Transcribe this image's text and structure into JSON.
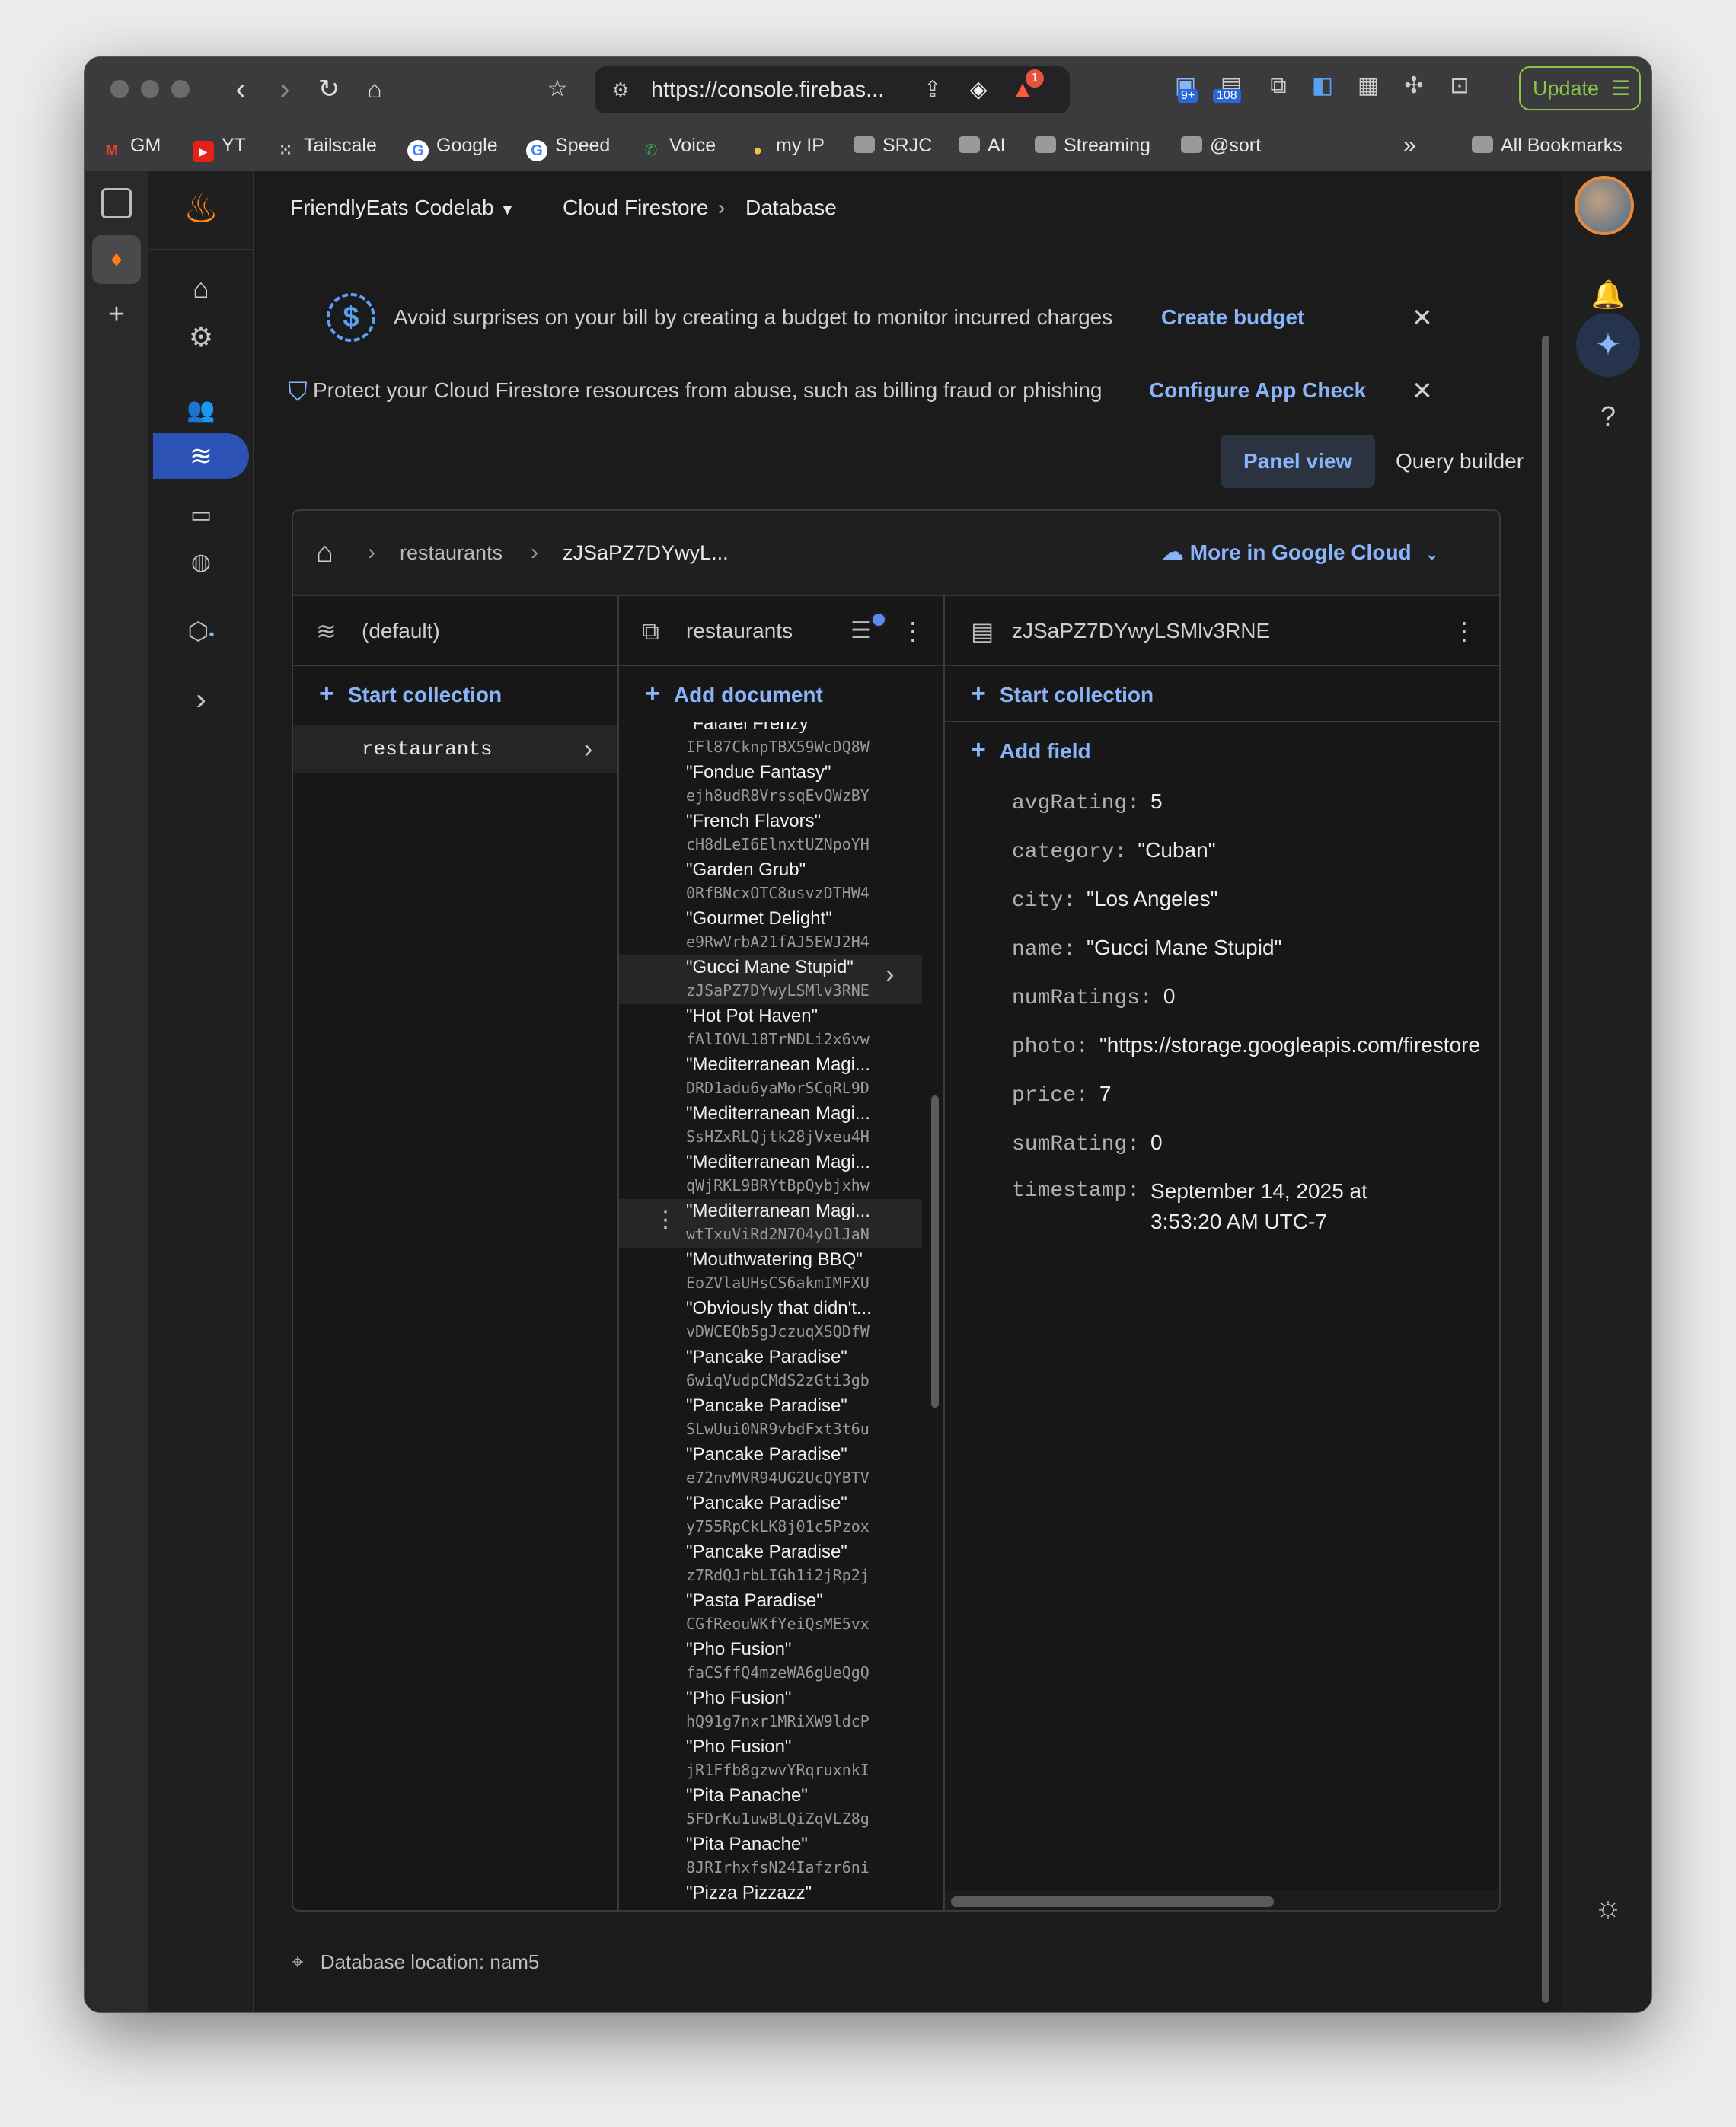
{
  "browser": {
    "url": "https://console.firebas...",
    "update_label": "Update",
    "badges": {
      "alert": "1",
      "ext1": "9+",
      "ext2": "108"
    },
    "bookmarks": [
      "GM",
      "YT",
      "Tailscale",
      "Google",
      "Speed",
      "Voice",
      "my IP",
      "SRJC",
      "AI",
      "Streaming",
      "@sort"
    ],
    "all_bookmarks": "All Bookmarks",
    "more": "»"
  },
  "header": {
    "project": "FriendlyEats Codelab",
    "crumb1": "Cloud Firestore",
    "crumb2": "Database"
  },
  "banners": {
    "budget_text": "Avoid surprises on your bill by creating a budget to monitor incurred charges",
    "budget_action": "Create budget",
    "appcheck_text": "Protect your Cloud Firestore resources from abuse, such as billing fraud or phishing",
    "appcheck_action": "Configure App Check"
  },
  "view_tabs": {
    "panel": "Panel view",
    "query": "Query builder"
  },
  "path": {
    "seg1": "restaurants",
    "seg2": "zJSaPZ7DYwyL...",
    "more_cloud": "More in Google Cloud"
  },
  "columns": {
    "db": {
      "title": "(default)",
      "action": "Start collection",
      "items": [
        "restaurants"
      ]
    },
    "collection": {
      "title": "restaurants",
      "action": "Add document"
    },
    "document": {
      "title": "zJSaPZ7DYwyLSMlv3RNE",
      "action1": "Start collection",
      "action2": "Add field"
    }
  },
  "documents": [
    {
      "name": "\"Falafel Frenzy\"",
      "id": "IFl87CknpTBX59WcDQ8W"
    },
    {
      "name": "\"Fondue Fantasy\"",
      "id": "ejh8udR8VrssqEvQWzBY"
    },
    {
      "name": "\"French Flavors\"",
      "id": "cH8dLeI6ElnxtUZNpoYH"
    },
    {
      "name": "\"Garden Grub\"",
      "id": "0RfBNcxOTC8usvzDTHW4"
    },
    {
      "name": "\"Gourmet Delight\"",
      "id": "e9RwVrbA21fAJ5EWJ2H4"
    },
    {
      "name": "\"Gucci Mane Stupid\"",
      "id": "zJSaPZ7DYwyLSMlv3RNE"
    },
    {
      "name": "\"Hot Pot Haven\"",
      "id": "fAlIOVL18TrNDLi2x6vw"
    },
    {
      "name": "\"Mediterranean Magi...",
      "id": "DRD1adu6yaMorSCqRL9D"
    },
    {
      "name": "\"Mediterranean Magi...",
      "id": "SsHZxRLQjtk28jVxeu4H"
    },
    {
      "name": "\"Mediterranean Magi...",
      "id": "qWjRKL9BRYtBpQybjxhw"
    },
    {
      "name": "\"Mediterranean Magi...",
      "id": "wtTxuViRd2N7O4yOlJaN"
    },
    {
      "name": "\"Mouthwatering BBQ\"",
      "id": "EoZVlaUHsCS6akmIMFXU"
    },
    {
      "name": "\"Obviously that didn't...",
      "id": "vDWCEQb5gJczuqXSQDfW"
    },
    {
      "name": "\"Pancake Paradise\"",
      "id": "6wiqVudpCMdS2zGti3gb"
    },
    {
      "name": "\"Pancake Paradise\"",
      "id": "SLwUui0NR9vbdFxt3t6u"
    },
    {
      "name": "\"Pancake Paradise\"",
      "id": "e72nvMVR94UG2UcQYBTV"
    },
    {
      "name": "\"Pancake Paradise\"",
      "id": "y755RpCkLK8j01c5Pzox"
    },
    {
      "name": "\"Pancake Paradise\"",
      "id": "z7RdQJrbLIGh1i2jRp2j"
    },
    {
      "name": "\"Pasta Paradise\"",
      "id": "CGfReouWKfYeiQsME5vx"
    },
    {
      "name": "\"Pho Fusion\"",
      "id": "faCSffQ4mzeWA6gUeQgQ"
    },
    {
      "name": "\"Pho Fusion\"",
      "id": "hQ91g7nxr1MRiXW9ldcP"
    },
    {
      "name": "\"Pho Fusion\"",
      "id": "jR1Ffb8gzwvYRqruxnkI"
    },
    {
      "name": "\"Pita Panache\"",
      "id": "5FDrKu1uwBLQiZqVLZ8g"
    },
    {
      "name": "\"Pita Panache\"",
      "id": "8JRIrhxfsN24Iafzr6ni"
    },
    {
      "name": "\"Pizza Pizzazz\"",
      "id": ""
    }
  ],
  "fields": [
    {
      "key": "avgRating:",
      "value": "5"
    },
    {
      "key": "category:",
      "value": "\"Cuban\""
    },
    {
      "key": "city:",
      "value": "\"Los Angeles\""
    },
    {
      "key": "name:",
      "value": "\"Gucci Mane Stupid\""
    },
    {
      "key": "numRatings:",
      "value": "0"
    },
    {
      "key": "photo:",
      "value": "\"https://storage.googleapis.com/firestore"
    },
    {
      "key": "price:",
      "value": "7"
    },
    {
      "key": "sumRating:",
      "value": "0"
    },
    {
      "key": "timestamp:",
      "value": "September 14, 2025 at",
      "value2": "3:53:20 AM UTC-7"
    }
  ],
  "footer": {
    "location": "Database location: nam5"
  },
  "colors": {
    "accent": "#8ab4f8",
    "selected_nav": "#2d52b6",
    "update": "#8bc34a"
  }
}
